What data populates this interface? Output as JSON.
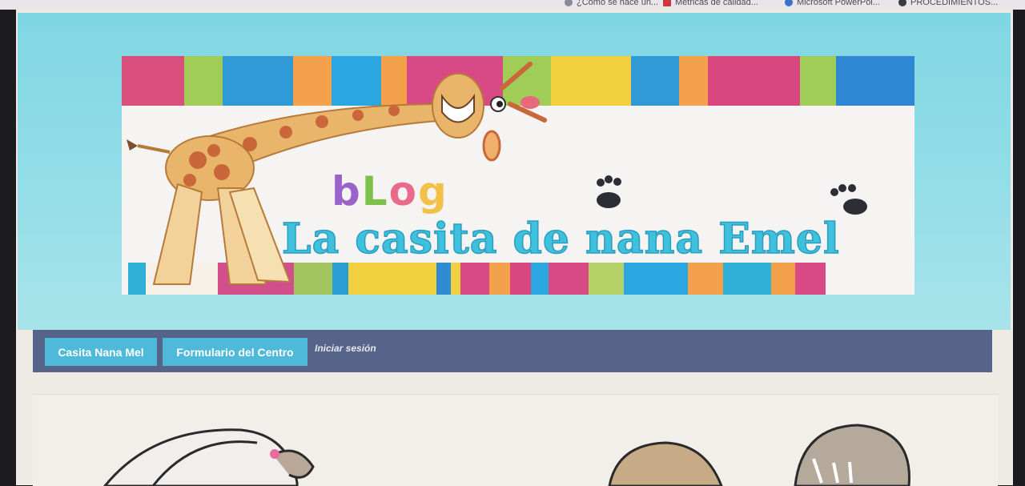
{
  "bookmarks": [
    {
      "label": "¿Cómo se hace un...",
      "icon": "bookmark-icon",
      "color": "#7a7a88"
    },
    {
      "label": "Métricas de calidad...",
      "icon": "chart-icon",
      "color": "#d0363c"
    },
    {
      "label": "Microsoft PowerPoi...",
      "icon": "powerpoint-icon",
      "color": "#3b72c8"
    },
    {
      "label": "PROCEDIMIENTOS...",
      "icon": "globe-icon",
      "color": "#3a3a44"
    }
  ],
  "banner": {
    "blog_letters": [
      "b",
      "L",
      "o",
      "g"
    ],
    "title": "La casita de nana Emel"
  },
  "nav": {
    "items": [
      {
        "label": "Casita Nana Mel"
      },
      {
        "label": "Formulario del Centro"
      }
    ],
    "login_label": "Iniciar sesión"
  },
  "colors": {
    "header_cyan": "#86d9e5",
    "nav_bar": "#56648a",
    "nav_button": "#4fb9d9",
    "title_blue": "#3fc1de"
  }
}
